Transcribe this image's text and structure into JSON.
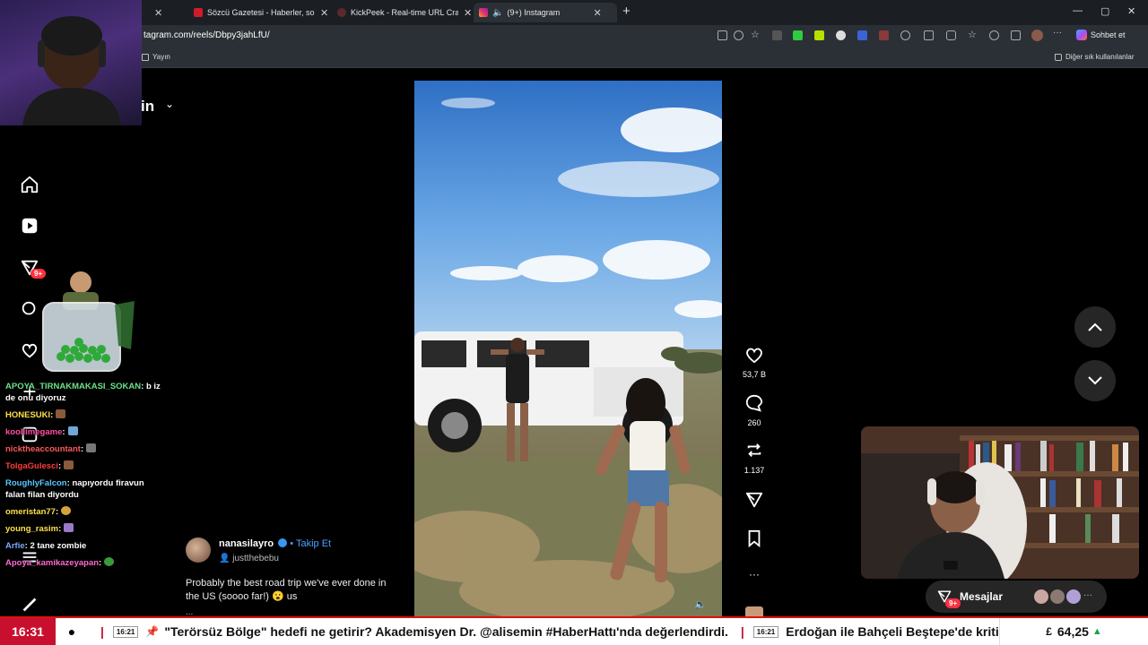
{
  "browser": {
    "tabs": [
      {
        "title": "",
        "favicon_color": "#444"
      },
      {
        "title": "Sözcü Gazetesi - Haberler, son da",
        "favicon_color": "#d11a2a"
      },
      {
        "title": "KickPeek - Real-time URL Crawler",
        "favicon_color": "#2b2b2b"
      },
      {
        "title": "(9+) Instagram",
        "favicon_color": "#e1306c"
      }
    ],
    "new_tab": "+",
    "window_controls": [
      "—",
      "▢",
      "✕"
    ],
    "url_prefix": "",
    "url_main": "tagram.com/reels/Dbpy3jahLfU/",
    "sohbet_label": "Sohbet et",
    "bookmark_left": "Yayın",
    "bookmark_right": "Diğer sık kullanılanlar"
  },
  "instagram": {
    "header_title": "in",
    "notif_badge": "9+",
    "post": {
      "username": "nanasilayro",
      "follow_label": "• Takip Et",
      "audio": "justthebebu",
      "caption": "Probably the best road trip we've ever done in the US (soooo far!) 😮 us",
      "ellipsis": "..."
    },
    "actions": {
      "likes": "53,7 B",
      "comments": "260",
      "reposts": "1.137"
    },
    "messages": {
      "label": "Mesajlar",
      "badge": "9+",
      "more": "···"
    }
  },
  "chat": {
    "messages": [
      {
        "user": "APOYA_TIRNAKMAKASI_SOKAN",
        "user_color": "#6ae38a",
        "text": "b iz de onu diyoruz",
        "emote": ""
      },
      {
        "user": "HONESUKI",
        "user_color": "#ffe14a",
        "text": "",
        "emote": "#8a5a3a"
      },
      {
        "user": "koollimegame",
        "user_color": "#ff4fa3",
        "text": "",
        "emote": "#6fa8d6"
      },
      {
        "user": "nicktheaccountant",
        "user_color": "#ff5a5a",
        "text": "",
        "emote": "#777777"
      },
      {
        "user": "TolgaGulesci",
        "user_color": "#ff3b3b",
        "text": "",
        "emote": "#8a5a3a"
      },
      {
        "user": "RoughlyFalcon",
        "user_color": "#5ac8ff",
        "text": "napıyordu firavun falan filan diyordu",
        "emote": ""
      },
      {
        "user": "omeristan77",
        "user_color": "#ffe14a",
        "text": "",
        "emote": "#d6a23a"
      },
      {
        "user": "young_rasim",
        "user_color": "#ffe14a",
        "text": "",
        "emote": "#9a7ac8"
      },
      {
        "user": "Arfie",
        "user_color": "#7aa8ff",
        "text": "2 tane zombie",
        "emote": ""
      },
      {
        "user": "Apoya_kamikazeyapan",
        "user_color": "#ff6ad1",
        "text": "",
        "emote": "#3a9a3a"
      }
    ]
  },
  "ticker": {
    "clock": "16:31",
    "dot": "●",
    "items": [
      {
        "time": "16:21",
        "text": "\"Terörsüz Bölge\" hedefi ne getirir? Akademisyen Dr. @alisemin #HaberHattı'nda değerlendirdi."
      },
      {
        "time": "16:21",
        "text": "Erdoğan ile Bahçeli Beştepe'de kritik z"
      }
    ],
    "currency_symbol": "£",
    "currency_value": "64,25",
    "currency_trend": "▲"
  },
  "colors": {
    "ticker_red": "#c8102e",
    "follow_blue": "#4ca2ff",
    "badge_red": "#ff3040"
  }
}
